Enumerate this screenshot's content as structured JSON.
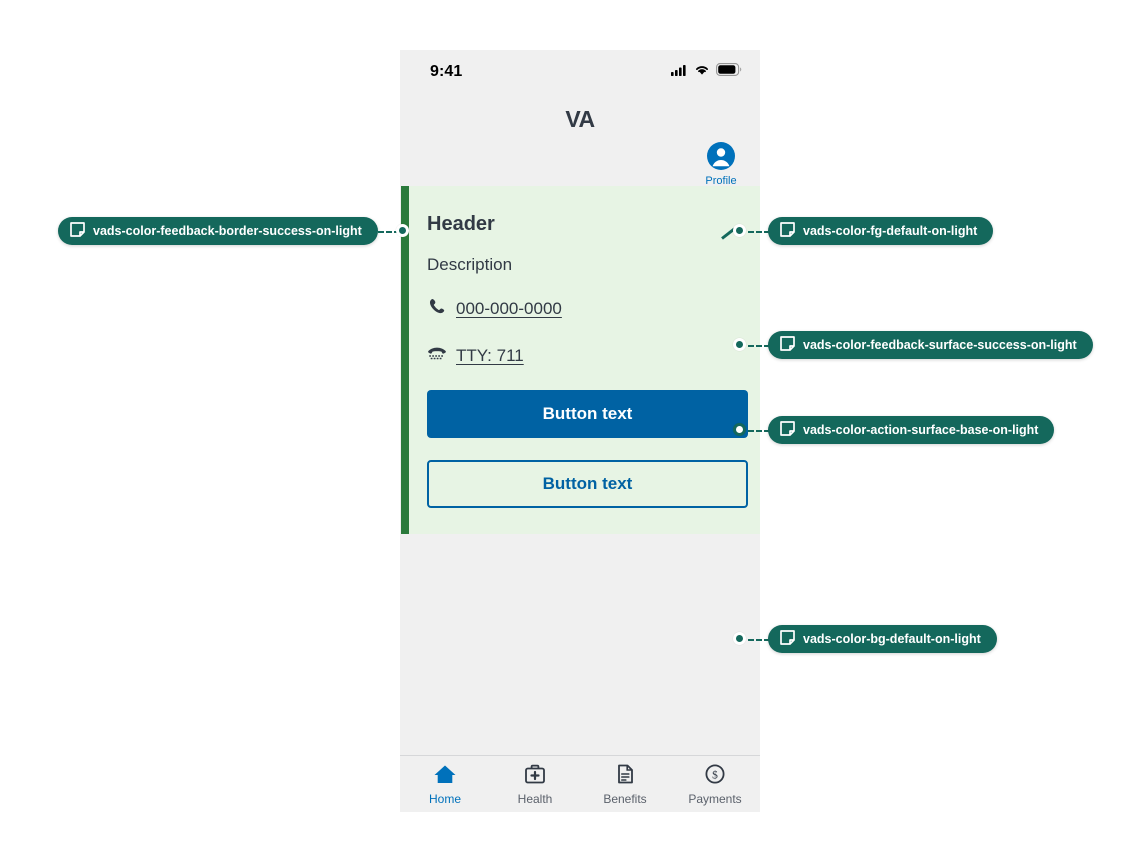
{
  "phone": {
    "statusbar": {
      "time": "9:41",
      "icons": [
        "cellular-signal-icon",
        "wifi-icon",
        "battery-icon"
      ]
    },
    "appheader": {
      "logo": "VA",
      "profile_label": "Profile",
      "profile_icon": "profile-avatar-icon"
    },
    "alert_card": {
      "header": "Header",
      "description": "Description",
      "phone_icon": "phone-handset-icon",
      "phone_number": "000-000-0000",
      "tty_icon": "tty-teletype-icon",
      "tty_text": "TTY: 711",
      "primary_button": "Button text",
      "secondary_button": "Button text"
    },
    "bottom_nav": [
      {
        "label": "Home",
        "icon": "home-icon",
        "active": true
      },
      {
        "label": "Health",
        "icon": "medical-kit-icon",
        "active": false
      },
      {
        "label": "Benefits",
        "icon": "document-icon",
        "active": false
      },
      {
        "label": "Payments",
        "icon": "dollar-circle-icon",
        "active": false
      }
    ]
  },
  "annotations": [
    {
      "label": "vads-color-feedback-border-success-on-light",
      "icon": "color-token-icon"
    },
    {
      "label": "vads-color-fg-default-on-light",
      "icon": "color-token-icon"
    },
    {
      "label": "vads-color-feedback-surface-success-on-light",
      "icon": "color-token-icon"
    },
    {
      "label": "vads-color-action-surface-base-on-light",
      "icon": "color-token-icon"
    },
    {
      "label": "vads-color-bg-default-on-light",
      "icon": "color-token-icon"
    }
  ],
  "colors": {
    "pill_bg": "#14685c",
    "card_surface": "#e7f4e4",
    "card_border": "#2a7a3b",
    "action_surface": "#0062a3",
    "page_bg": "#f0f0f0",
    "fg_default": "#323a45"
  }
}
